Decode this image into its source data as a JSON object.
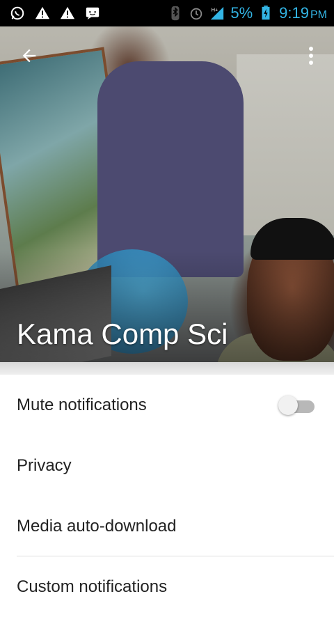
{
  "status_bar": {
    "battery_percent": "5%",
    "network": "H+",
    "time": "9:19",
    "ampm": "PM",
    "left_icons": [
      "whatsapp-icon",
      "warning-icon",
      "warning-icon",
      "chat-icon"
    ],
    "right_icons": [
      "bluetooth-icon",
      "alarm-icon",
      "signal-icon",
      "battery-charging-icon"
    ]
  },
  "header": {
    "title": "Kama Comp Sci",
    "back_icon": "arrow-back-icon",
    "menu_icon": "more-vert-icon"
  },
  "settings": [
    {
      "label": "Mute notifications",
      "toggle": false
    },
    {
      "label": "Privacy"
    },
    {
      "label": "Media auto-download"
    },
    {
      "label": "Custom notifications"
    }
  ],
  "colors": {
    "status_accent": "#33b5e5",
    "text": "#222222"
  }
}
